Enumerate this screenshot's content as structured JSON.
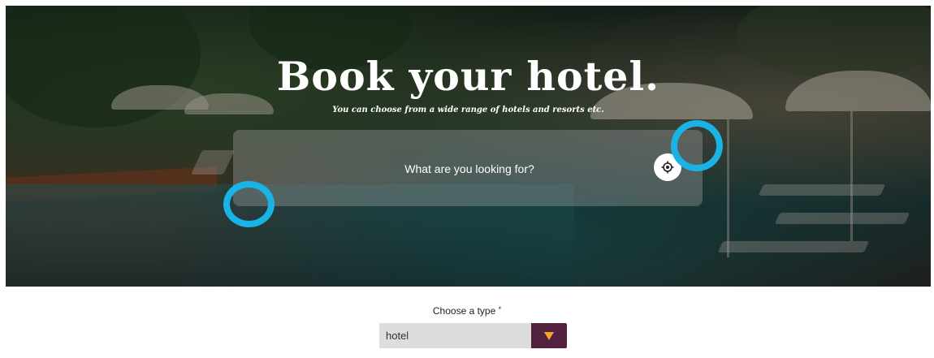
{
  "hero": {
    "title": "Book your hotel.",
    "subtitle": "You can choose from a wide range of hotels and resorts etc."
  },
  "search": {
    "placeholder": "What are you looking for?",
    "locate_icon": "crosshair-icon"
  },
  "type_select": {
    "label": "Choose a type",
    "required_mark": "*",
    "selected": "hotel",
    "arrow_icon": "chevron-down-icon",
    "arrow_color": "#f5a623",
    "button_color": "#52213f"
  },
  "colors": {
    "highlight_ring": "#19b3e6"
  }
}
